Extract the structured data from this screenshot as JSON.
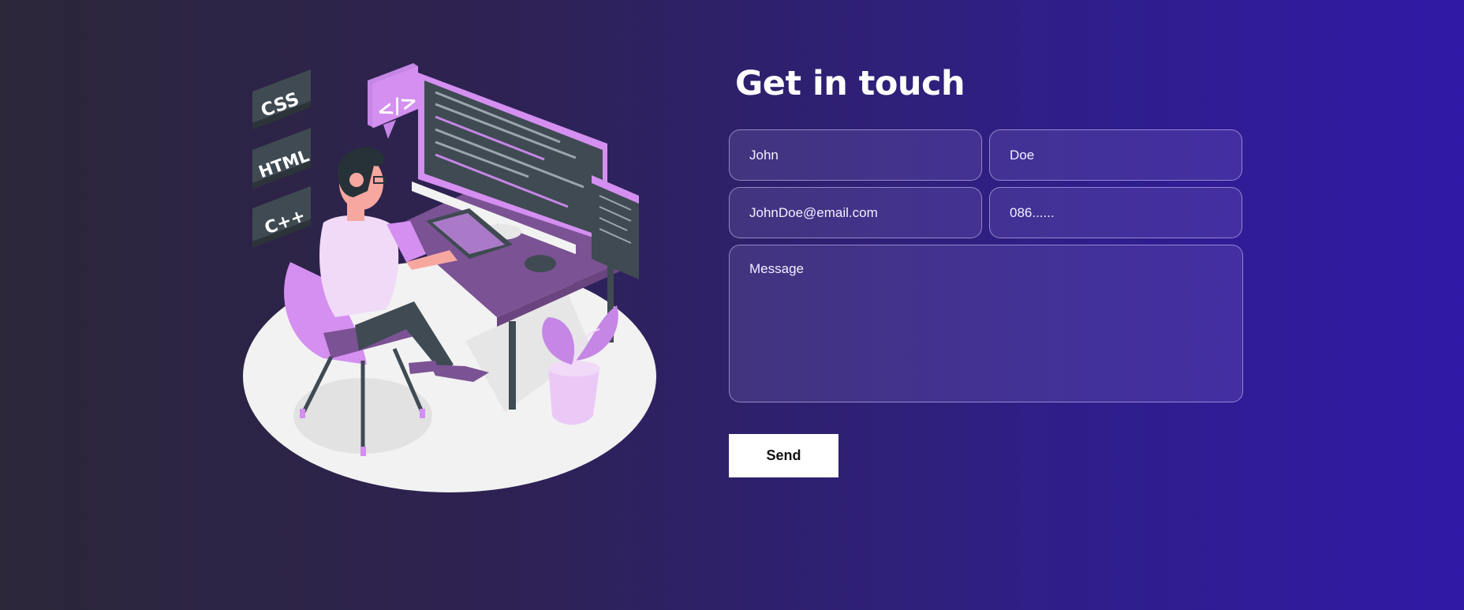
{
  "illustration": {
    "tags": [
      "CSS",
      "HTML",
      "C++"
    ],
    "code_bubble": "</>",
    "colors": {
      "lilac": "#d48ff0",
      "purple": "#7b5294",
      "slate": "#3f4a52",
      "floor": "#f2f2f2"
    }
  },
  "contact": {
    "title": "Get in touch",
    "first_name": {
      "placeholder": "John"
    },
    "last_name": {
      "placeholder": "Doe"
    },
    "email": {
      "placeholder": "JohnDoe@email.com"
    },
    "phone": {
      "placeholder": "086......"
    },
    "message": {
      "placeholder": "Message"
    },
    "send_label": "Send"
  }
}
